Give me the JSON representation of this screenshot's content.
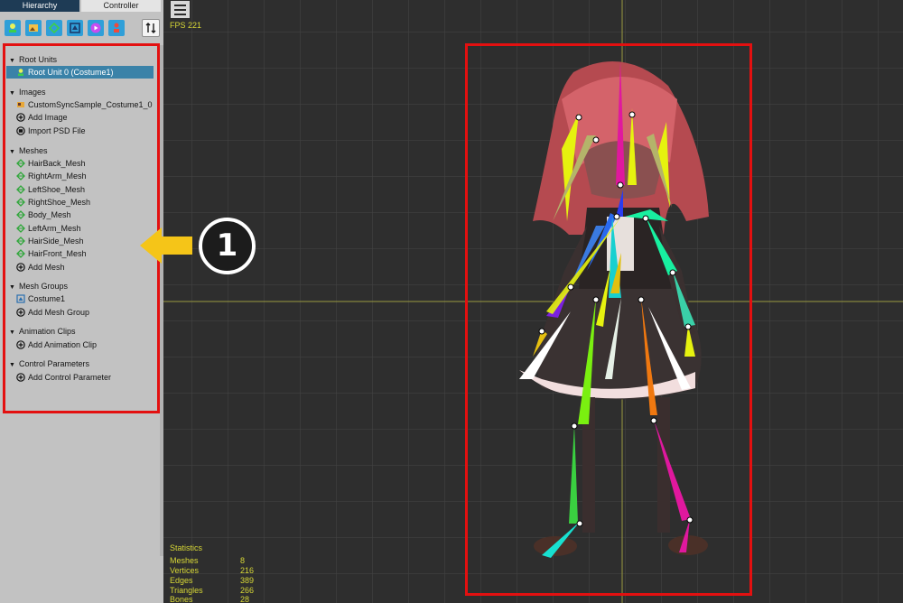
{
  "tabs": {
    "hierarchy": "Hierarchy",
    "controller": "Controller"
  },
  "toolbar": [
    {
      "icon": "root-unit-icon",
      "color": "#2f9fd8"
    },
    {
      "icon": "image-icon",
      "color": "#2f9fd8"
    },
    {
      "icon": "mesh-icon",
      "color": "#2f9fd8"
    },
    {
      "icon": "mesh-group-icon",
      "color": "#2f9fd8"
    },
    {
      "icon": "animation-icon",
      "color": "#2f9fd8"
    },
    {
      "icon": "control-parameter-icon",
      "color": "#2f9fd8"
    }
  ],
  "sections": {
    "root_units": {
      "title": "Root Units",
      "items": [
        "Root Unit 0 (Costume1)"
      ]
    },
    "images": {
      "title": "Images",
      "items": [
        "CustomSyncSample_Costume1_0",
        "Add Image",
        "Import PSD File"
      ]
    },
    "meshes": {
      "title": "Meshes",
      "items": [
        "HairBack_Mesh",
        "RightArm_Mesh",
        "LeftShoe_Mesh",
        "RightShoe_Mesh",
        "Body_Mesh",
        "LeftArm_Mesh",
        "HairSide_Mesh",
        "HairFront_Mesh",
        "Add Mesh"
      ]
    },
    "mesh_groups": {
      "title": "Mesh Groups",
      "items": [
        "Costume1",
        "Add Mesh Group"
      ]
    },
    "animation_clips": {
      "title": "Animation Clips",
      "items": [
        "Add Animation Clip"
      ]
    },
    "control_parameters": {
      "title": "Control Parameters",
      "items": [
        "Add Control Parameter"
      ]
    }
  },
  "callout": {
    "number": "1",
    "arrow_color": "#f5c518"
  },
  "viewport": {
    "fps": "FPS 221",
    "statistics": {
      "title": "Statistics",
      "rows": [
        {
          "label": "Meshes",
          "value": "8"
        },
        {
          "label": "Vertices",
          "value": "216"
        },
        {
          "label": "Edges",
          "value": "389"
        },
        {
          "label": "Triangles",
          "value": "266"
        },
        {
          "label": "Bones",
          "value": "28"
        }
      ]
    }
  },
  "colors": {
    "highlight": "#e31010",
    "selection": "#3a82a8",
    "stats_text": "#d8d836"
  }
}
